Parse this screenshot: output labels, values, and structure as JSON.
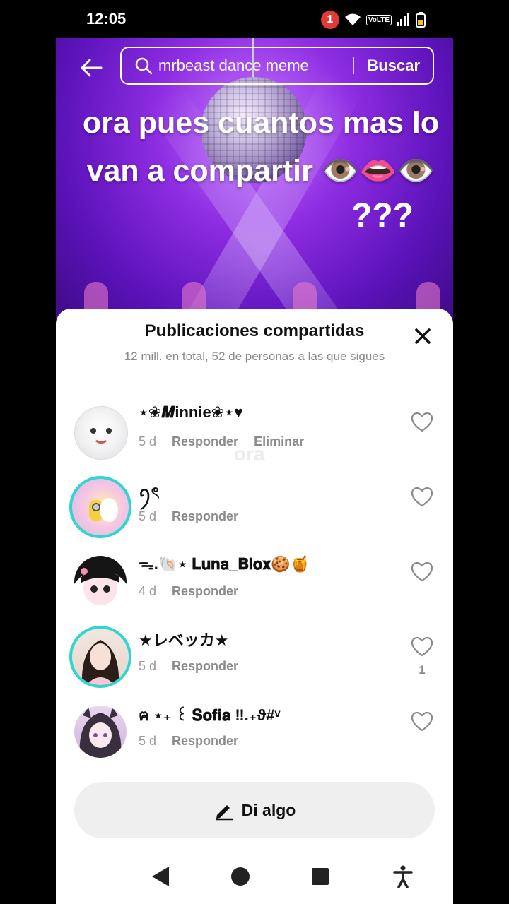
{
  "status_bar": {
    "time": "12:05",
    "notification_count": "1",
    "network_label": "VoLTE"
  },
  "search": {
    "query": "mrbeast dance meme",
    "button_label": "Buscar"
  },
  "video": {
    "caption_line1": "ora pues cuantos mas lo",
    "caption_line2": "van a compartir 👁️👄👁️",
    "caption_line3": "???",
    "accent_color": "#8e2de2"
  },
  "sheet": {
    "title": "Publicaciones compartidas",
    "subtitle": "12 mill. en total, 52 de personas a las que sigues",
    "close_icon": "close-icon",
    "faded_text": "ora"
  },
  "shares": [
    {
      "username": "⋆❀𝑴innie❀⋆♥",
      "age": "5 d",
      "reply": "Responder",
      "delete": "Eliminar",
      "likes": ""
    },
    {
      "username": "ꪆৎ",
      "age": "5 d",
      "reply": "Responder",
      "likes": ""
    },
    {
      "username": "ᯓ.🐚⋆ 𝐋𝐮𝐧𝐚_𝐁𝐥𝐨𝐱🍪🍯",
      "age": "4 d",
      "reply": "Responder",
      "likes": ""
    },
    {
      "username": "★レベッカ★",
      "age": "5 d",
      "reply": "Responder",
      "likes": "1"
    },
    {
      "username": "ฅ ⋆₊ ꒰ 𝐒𝐨𝐟𝐢𝐚 ‼.₊ϑ#ᵛ",
      "age": "5 d",
      "reply": "Responder",
      "likes": ""
    }
  ],
  "composer": {
    "label": "Di algo"
  }
}
